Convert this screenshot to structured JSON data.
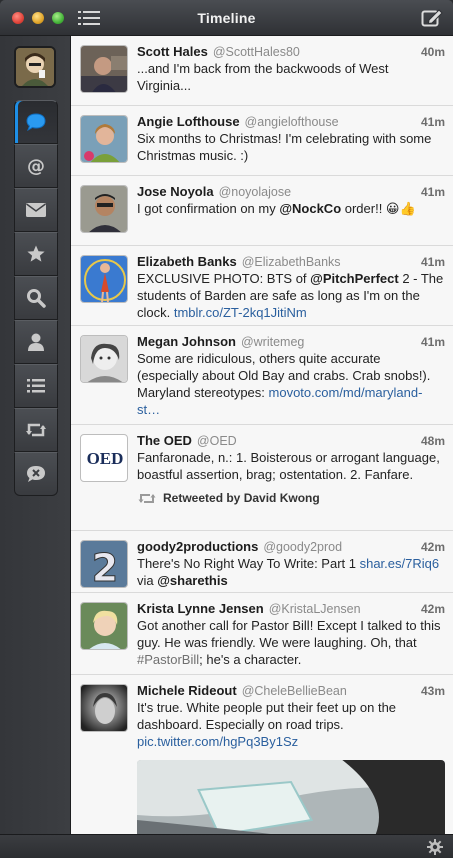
{
  "window": {
    "title": "Timeline"
  },
  "colors": {
    "accent": "#1e8fe6",
    "link": "#2a5f9e",
    "sidebar": "#3a3c40"
  },
  "sidebar": {
    "items": [
      {
        "icon": "speech-bubble-icon",
        "active": true
      },
      {
        "icon": "at-sign-icon",
        "active": false
      },
      {
        "icon": "envelope-icon",
        "active": false
      },
      {
        "icon": "star-icon",
        "active": false
      },
      {
        "icon": "search-icon",
        "active": false
      },
      {
        "icon": "user-icon",
        "active": false
      },
      {
        "icon": "list-icon",
        "active": false
      },
      {
        "icon": "retweet-icon",
        "active": false
      },
      {
        "icon": "muted-bubble-icon",
        "active": false
      }
    ]
  },
  "tweets": [
    {
      "name": "Scott Hales",
      "handle": "@ScottHales80",
      "time": "40m",
      "text": "...and I'm back from the backwoods of West Virginia..."
    },
    {
      "name": "Angie Lofthouse",
      "handle": "@angielofthouse",
      "time": "41m",
      "text": "Six months to Christmas! I'm celebrating with some Christmas music. :)"
    },
    {
      "name": "Jose Noyola",
      "handle": "@noyolajose",
      "time": "41m",
      "text_pre": "I got confirmation on my ",
      "mention": "@NockCo",
      "text_post": " order!! 😀👍"
    },
    {
      "name": "Elizabeth Banks",
      "handle": "@ElizabethBanks",
      "time": "41m",
      "text_pre": "EXCLUSIVE PHOTO: BTS of ",
      "mention": "@PitchPerfect",
      "text_post": " 2 - The students of Barden are safe as long as I'm on the clock. ",
      "link": "tmblr.co/ZT-2kq1JitiNm"
    },
    {
      "name": "Megan Johnson",
      "handle": "@writemeg",
      "time": "41m",
      "text_pre": "Some are ridiculous, others quite accurate (especially about Old Bay and crabs. Crab snobs!). Maryland stereotypes: ",
      "link": "movoto.com/md/maryland-st…"
    },
    {
      "name": "The OED",
      "handle": "@OED",
      "time": "48m",
      "text": "Fanfaronade, n.: 1. Boisterous or arrogant language, boastful assertion, brag; ostentation. 2. Fanfare.",
      "retweeted_by": "Retweeted by David Kwong",
      "avatar_text": "OED"
    },
    {
      "name": "goody2productions",
      "handle": "@goody2prod",
      "time": "42m",
      "text_pre": "There's No Right Way To Write: Part 1 ",
      "link": "shar.es/7Riq6",
      "text_mid": " via ",
      "mention": "@sharethis"
    },
    {
      "name": "Krista Lynne Jensen",
      "handle": "@KristaLJensen",
      "time": "42m",
      "text_pre": "Got another call for Pastor Bill! Except I talked to this guy. He was friendly. We were laughing. Oh, that ",
      "hashtag": "#PastorBill",
      "text_post": "; he's a character."
    },
    {
      "name": "Michele Rideout",
      "handle": "@CheleBellieBean",
      "time": "43m",
      "text_pre": "It's true. White people put their feet up on the dashboard. Especially on road trips. ",
      "link": "pic.twitter.com/hgPq3By1Sz"
    }
  ]
}
